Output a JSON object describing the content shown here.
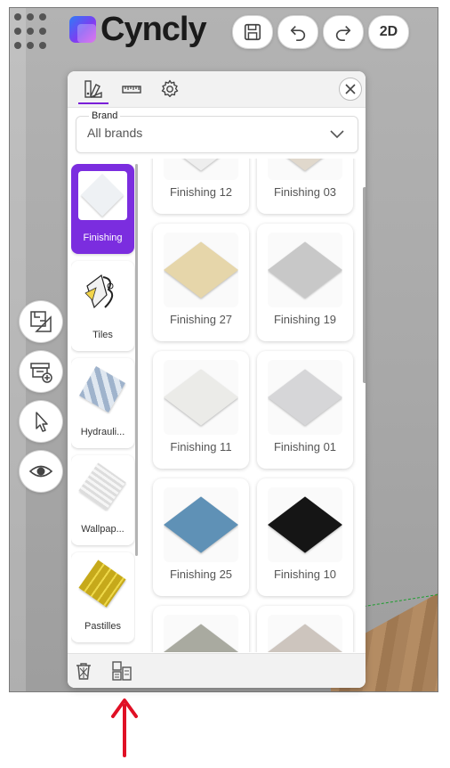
{
  "app": {
    "logo_text": "Cyncly"
  },
  "toolbar": {
    "save_icon": "save-icon",
    "undo_icon": "undo-icon",
    "redo_icon": "redo-icon",
    "view_toggle_label": "2D"
  },
  "side_tools": [
    "floorplan-icon",
    "furniture-add-icon",
    "cursor-icon",
    "eye-icon"
  ],
  "panel": {
    "tabs": [
      "palette-icon",
      "ruler-icon",
      "gear-icon"
    ],
    "active_tab": 0,
    "brand": {
      "label": "Brand",
      "value": "All brands"
    },
    "categories": [
      {
        "label": "Finishing",
        "active": true,
        "thumb_color": "#e9eef2"
      },
      {
        "label": "Tiles",
        "active": false,
        "thumb_color": "#f3f3f3"
      },
      {
        "label": "Hydrauli...",
        "active": false,
        "thumb_color": "#b9c6d6"
      },
      {
        "label": "Wallpap...",
        "active": false,
        "thumb_color": "#e6e4e4"
      },
      {
        "label": "Pastilles",
        "active": false,
        "thumb_color": "#d9c22b"
      }
    ],
    "finishes": [
      {
        "label": "Finishing 12",
        "color": "#eeeeee"
      },
      {
        "label": "Finishing 03",
        "color": "#e0d8cc"
      },
      {
        "label": "Finishing 27",
        "color": "#e6d6aa"
      },
      {
        "label": "Finishing 19",
        "color": "#c8c8c8"
      },
      {
        "label": "Finishing 11",
        "color": "#ebebe8"
      },
      {
        "label": "Finishing 01",
        "color": "#d6d6d8"
      },
      {
        "label": "Finishing 25",
        "color": "#5f91b6"
      },
      {
        "label": "Finishing 10",
        "color": "#151515"
      },
      {
        "label": "",
        "color": "#a9aaa0"
      },
      {
        "label": "",
        "color": "#cdc5be"
      }
    ]
  },
  "footer": {
    "left_icon": "trash-icon",
    "right_icon": "catalog-layout-icon"
  },
  "colors": {
    "accent": "#7a1fd8",
    "annotation_arrow": "#e01025"
  }
}
